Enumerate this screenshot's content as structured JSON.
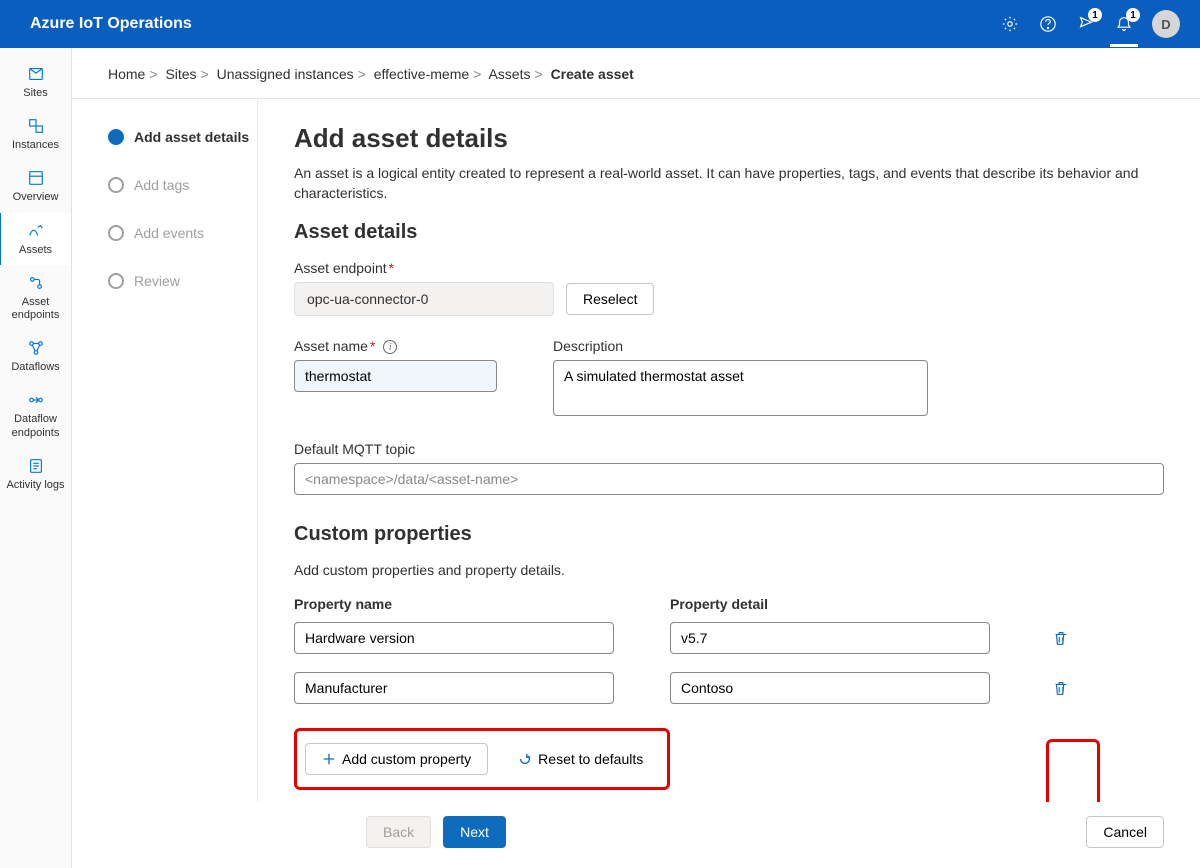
{
  "header": {
    "title": "Azure IoT Operations",
    "badge1": "1",
    "badge2": "1",
    "avatar_initial": "D"
  },
  "sidebar": {
    "items": [
      {
        "label": "Sites",
        "key": "sites"
      },
      {
        "label": "Instances",
        "key": "instances"
      },
      {
        "label": "Overview",
        "key": "overview"
      },
      {
        "label": "Assets",
        "key": "assets"
      },
      {
        "label": "Asset endpoints",
        "key": "asset-endpoints"
      },
      {
        "label": "Dataflows",
        "key": "dataflows"
      },
      {
        "label": "Dataflow endpoints",
        "key": "dataflow-endpoints"
      },
      {
        "label": "Activity logs",
        "key": "activity-logs"
      }
    ],
    "active": "assets"
  },
  "breadcrumb": {
    "items": [
      "Home",
      "Sites",
      "Unassigned instances",
      "effective-meme",
      "Assets"
    ],
    "current": "Create asset"
  },
  "wizard": {
    "steps": [
      "Add asset details",
      "Add tags",
      "Add events",
      "Review"
    ],
    "active_index": 0
  },
  "page": {
    "title": "Add asset details",
    "description": "An asset is a logical entity created to represent a real-world asset. It can have properties, tags, and events that describe its behavior and characteristics."
  },
  "asset_details": {
    "section_title": "Asset details",
    "endpoint_label": "Asset endpoint",
    "endpoint_value": "opc-ua-connector-0",
    "reselect_label": "Reselect",
    "name_label": "Asset name",
    "name_value": "thermostat",
    "desc_label": "Description",
    "desc_value": "A simulated thermostat asset",
    "mqtt_label": "Default MQTT topic",
    "mqtt_placeholder": "<namespace>/data/<asset-name>"
  },
  "custom_props": {
    "section_title": "Custom properties",
    "subtitle": "Add custom properties and property details.",
    "col_name": "Property name",
    "col_detail": "Property detail",
    "rows": [
      {
        "name": "Hardware version",
        "detail": "v5.7"
      },
      {
        "name": "Manufacturer",
        "detail": "Contoso"
      }
    ],
    "add_label": "Add custom property",
    "reset_label": "Reset to defaults"
  },
  "footer": {
    "back": "Back",
    "next": "Next",
    "cancel": "Cancel"
  }
}
